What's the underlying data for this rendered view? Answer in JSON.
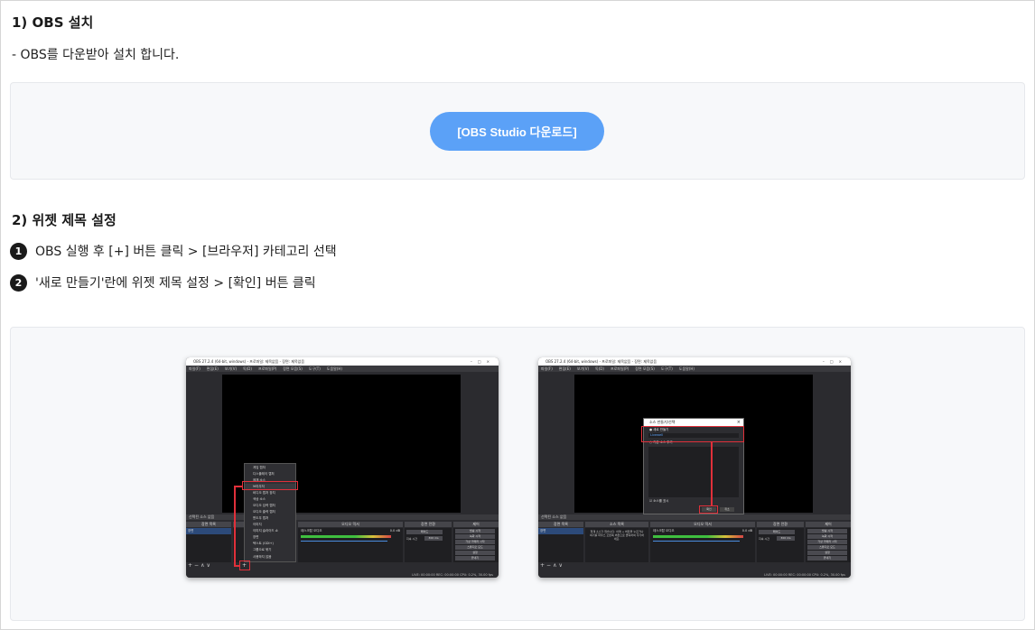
{
  "section1": {
    "title": "1) OBS 설치",
    "desc": "- OBS를 다운받아 설치 합니다.",
    "download_label": "[OBS Studio 다운로드]"
  },
  "section2": {
    "title": "2) 위젯 제목 설정",
    "steps": [
      {
        "num": "1",
        "text": "OBS 실행 후 [+] 버튼 클릭 > [브라우저] 카테고리 선택"
      },
      {
        "num": "2",
        "text": "'새로 만들기'란에 위젯 제목 설정 > [확인] 버튼 클릭"
      }
    ]
  },
  "screenshots": {
    "left": {
      "window_title": "OBS 27.2.4 (64-bit, windows) - 프로파일: 제목없음 - 장면: 제목없음",
      "menu": [
        "파일(F)",
        "편집(E)",
        "보기(V)",
        "독(D)",
        "프로파일(P)",
        "장면 모음(S)",
        "도구(T)",
        "도움말(H)"
      ],
      "dock_title": "선택된 소스 없음",
      "docks": [
        "장면 목록",
        "소스 목록",
        "오디오 믹서",
        "장면 전환",
        "제어"
      ],
      "scene_item": "장면",
      "context_menu": [
        "게임 캡처",
        "디스플레이 캡처",
        "매체 소스",
        "브라우저",
        "비디오 캡처 장치",
        "색상 소스",
        "오디오 입력 캡처",
        "오디오 출력 캡처",
        "윈도우 캡처",
        "이미지",
        "이미지 슬라이드 쇼",
        "장면",
        "텍스트 (GDI+)",
        "그룹으로 묶기",
        "사용하지 않음"
      ],
      "mixer_label": "데스크탑 오디오",
      "mixer_db": "0.0 dB",
      "transition_select": "페이드",
      "transition_time_label": "지속 시간",
      "transition_time_value": "300 ms",
      "controls": [
        "방송 시작",
        "녹화 시작",
        "가상 카메라 시작",
        "스튜디오 모드",
        "설정",
        "끝내기"
      ],
      "status": "LIVE: 00:00:00   REC: 00:00:00   CPU: 0.2%, 30.00 fps"
    },
    "right": {
      "window_title": "OBS 27.2.4 (64-bit, windows) - 프로파일: 제목없음 - 장면: 제목없음",
      "menu": [
        "파일(F)",
        "편집(E)",
        "보기(V)",
        "독(D)",
        "프로파일(P)",
        "장면 모음(S)",
        "도구(T)",
        "도움말(H)"
      ],
      "dock_title": "선택된 소스 없음",
      "docks": [
        "장면 목록",
        "소스 목록",
        "오디오 믹서",
        "장면 전환",
        "제어"
      ],
      "scene_item": "장면",
      "dialog_title": "소스 만들기/선택",
      "dialog_new": "새로 만들기",
      "dialog_new_value": "Livewell",
      "dialog_existing": "기존 소스 추가",
      "dialog_visible": "소스를 표시",
      "dialog_ok": "확인",
      "dialog_cancel": "취소",
      "source_hint": "현재 소스가 없습니다. 아래 + 버튼을 누르거나 여기를 마우스 오른쪽 버튼으로 클릭하여 추가하세요.",
      "mixer_label": "데스크탑 오디오",
      "mixer_db": "0.0 dB",
      "transition_select": "페이드",
      "transition_time_label": "지속 시간",
      "transition_time_value": "300 ms",
      "controls": [
        "방송 시작",
        "녹화 시작",
        "가상 카메라 시작",
        "스튜디오 모드",
        "설정",
        "끝내기"
      ],
      "status": "LIVE: 00:00:00   REC: 00:00:00   CPU: 0.2%, 30.00 fps"
    }
  },
  "colors": {
    "accent": "#5ba1f7",
    "highlight": "#e0303a"
  }
}
